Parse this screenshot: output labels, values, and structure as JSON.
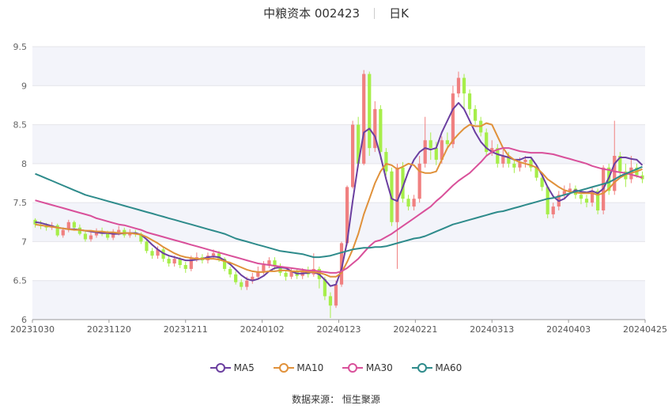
{
  "header": {
    "title": "中粮资本 002423",
    "period": "日K"
  },
  "source": {
    "label": "数据来源：",
    "name": "恒生聚源"
  },
  "colors": {
    "up": "#f08080",
    "down": "#a6ee4a",
    "MA5": "#6b3fa0",
    "MA10": "#e0913a",
    "MA30": "#d9509a",
    "MA60": "#2e8b8b",
    "grid_band": "#f3f4fa"
  },
  "chart_data": {
    "type": "candlestick",
    "ylim": [
      6,
      9.5
    ],
    "yticks": [
      "6",
      "6.5",
      "7",
      "7.5",
      "8",
      "8.5",
      "9",
      "9.5"
    ],
    "xticks": [
      "20231030",
      "20231120",
      "20231211",
      "20240102",
      "20240123",
      "20240221",
      "20240313",
      "20240403",
      "20240425"
    ],
    "candles": [
      [
        7.28,
        7.22,
        7.3,
        7.18
      ],
      [
        7.22,
        7.2,
        7.27,
        7.16
      ],
      [
        7.2,
        7.18,
        7.24,
        7.14
      ],
      [
        7.18,
        7.21,
        7.25,
        7.15
      ],
      [
        7.21,
        7.08,
        7.23,
        7.06
      ],
      [
        7.08,
        7.15,
        7.18,
        7.05
      ],
      [
        7.15,
        7.25,
        7.28,
        7.12
      ],
      [
        7.25,
        7.18,
        7.27,
        7.14
      ],
      [
        7.18,
        7.1,
        7.22,
        7.08
      ],
      [
        7.1,
        7.03,
        7.14,
        7.0
      ],
      [
        7.03,
        7.08,
        7.12,
        7.0
      ],
      [
        7.08,
        7.13,
        7.17,
        7.05
      ],
      [
        7.13,
        7.1,
        7.18,
        7.07
      ],
      [
        7.1,
        7.05,
        7.14,
        7.02
      ],
      [
        7.05,
        7.12,
        7.16,
        7.02
      ],
      [
        7.12,
        7.15,
        7.2,
        7.08
      ],
      [
        7.15,
        7.08,
        7.18,
        7.05
      ],
      [
        7.08,
        7.12,
        7.16,
        7.05
      ],
      [
        7.12,
        7.1,
        7.15,
        7.06
      ],
      [
        7.1,
        7.0,
        7.12,
        6.97
      ],
      [
        7.0,
        6.88,
        7.03,
        6.85
      ],
      [
        6.88,
        6.82,
        6.92,
        6.78
      ],
      [
        6.82,
        6.9,
        6.94,
        6.78
      ],
      [
        6.9,
        6.78,
        6.92,
        6.74
      ],
      [
        6.78,
        6.72,
        6.82,
        6.68
      ],
      [
        6.72,
        6.78,
        6.82,
        6.68
      ],
      [
        6.78,
        6.7,
        6.8,
        6.66
      ],
      [
        6.7,
        6.65,
        6.74,
        6.6
      ],
      [
        6.65,
        6.78,
        6.82,
        6.62
      ],
      [
        6.78,
        6.8,
        6.86,
        6.74
      ],
      [
        6.8,
        6.76,
        6.84,
        6.72
      ],
      [
        6.76,
        6.82,
        6.86,
        6.72
      ],
      [
        6.82,
        6.85,
        6.9,
        6.78
      ],
      [
        6.85,
        6.78,
        6.88,
        6.74
      ],
      [
        6.78,
        6.65,
        6.8,
        6.62
      ],
      [
        6.65,
        6.58,
        6.68,
        6.54
      ],
      [
        6.58,
        6.48,
        6.62,
        6.45
      ],
      [
        6.48,
        6.42,
        6.52,
        6.38
      ],
      [
        6.42,
        6.5,
        6.55,
        6.38
      ],
      [
        6.5,
        6.55,
        6.6,
        6.46
      ],
      [
        6.55,
        6.62,
        6.68,
        6.52
      ],
      [
        6.62,
        6.7,
        6.75,
        6.58
      ],
      [
        6.7,
        6.76,
        6.8,
        6.66
      ],
      [
        6.76,
        6.68,
        6.8,
        6.64
      ],
      [
        6.68,
        6.6,
        6.72,
        6.56
      ],
      [
        6.6,
        6.55,
        6.64,
        6.5
      ],
      [
        6.55,
        6.62,
        6.66,
        6.52
      ],
      [
        6.62,
        6.56,
        6.65,
        6.52
      ],
      [
        6.56,
        6.62,
        6.66,
        6.52
      ],
      [
        6.62,
        6.58,
        6.68,
        6.54
      ],
      [
        6.58,
        6.65,
        6.85,
        6.55
      ],
      [
        6.65,
        6.52,
        6.68,
        6.4
      ],
      [
        6.52,
        6.3,
        6.55,
        6.25
      ],
      [
        6.3,
        6.18,
        6.35,
        6.02
      ],
      [
        6.18,
        6.45,
        6.5,
        6.15
      ],
      [
        6.45,
        6.98,
        7.0,
        6.42
      ],
      [
        6.98,
        7.7,
        7.72,
        6.95
      ],
      [
        7.7,
        8.5,
        8.55,
        7.68
      ],
      [
        8.5,
        8.0,
        8.6,
        7.95
      ],
      [
        8.0,
        9.15,
        9.2,
        7.98
      ],
      [
        9.15,
        8.2,
        9.18,
        8.1
      ],
      [
        8.2,
        8.7,
        8.8,
        8.15
      ],
      [
        8.7,
        8.15,
        8.75,
        8.05
      ],
      [
        8.15,
        7.9,
        8.2,
        7.85
      ],
      [
        7.9,
        7.25,
        7.95,
        7.2
      ],
      [
        7.25,
        7.95,
        8.0,
        6.65
      ],
      [
        7.95,
        7.55,
        8.02,
        7.5
      ],
      [
        7.55,
        7.45,
        7.6,
        7.4
      ],
      [
        7.45,
        7.55,
        7.6,
        7.4
      ],
      [
        7.55,
        8.0,
        8.1,
        7.5
      ],
      [
        8.0,
        8.3,
        8.6,
        7.95
      ],
      [
        8.3,
        8.2,
        8.4,
        8.05
      ],
      [
        8.2,
        8.05,
        8.28,
        7.98
      ],
      [
        8.05,
        8.3,
        8.35,
        8.0
      ],
      [
        8.3,
        8.25,
        8.4,
        8.2
      ],
      [
        8.25,
        8.9,
        9.0,
        8.2
      ],
      [
        8.9,
        9.1,
        9.18,
        8.85
      ],
      [
        9.1,
        8.9,
        9.15,
        8.7
      ],
      [
        8.9,
        8.7,
        8.95,
        8.62
      ],
      [
        8.7,
        8.55,
        8.75,
        8.5
      ],
      [
        8.55,
        8.4,
        8.6,
        8.35
      ],
      [
        8.4,
        8.15,
        8.45,
        8.1
      ],
      [
        8.15,
        8.2,
        8.3,
        8.1
      ],
      [
        8.2,
        8.0,
        8.25,
        7.95
      ],
      [
        8.0,
        8.1,
        8.18,
        7.95
      ],
      [
        8.1,
        8.0,
        8.15,
        7.95
      ],
      [
        8.0,
        7.95,
        8.05,
        7.88
      ],
      [
        7.95,
        8.02,
        8.08,
        7.9
      ],
      [
        8.02,
        8.05,
        8.1,
        7.95
      ],
      [
        8.05,
        7.95,
        8.08,
        7.9
      ],
      [
        7.95,
        7.82,
        7.98,
        7.78
      ],
      [
        7.82,
        7.7,
        7.85,
        7.65
      ],
      [
        7.7,
        7.35,
        7.72,
        7.3
      ],
      [
        7.35,
        7.45,
        7.5,
        7.3
      ],
      [
        7.45,
        7.6,
        7.65,
        7.4
      ],
      [
        7.6,
        7.65,
        7.72,
        7.55
      ],
      [
        7.65,
        7.68,
        7.75,
        7.6
      ],
      [
        7.68,
        7.6,
        7.72,
        7.55
      ],
      [
        7.6,
        7.55,
        7.65,
        7.48
      ],
      [
        7.55,
        7.5,
        7.6,
        7.44
      ],
      [
        7.5,
        7.65,
        7.7,
        7.45
      ],
      [
        7.65,
        7.4,
        7.68,
        7.35
      ],
      [
        7.4,
        7.95,
        7.98,
        7.35
      ],
      [
        7.95,
        7.65,
        8.0,
        7.6
      ],
      [
        7.65,
        8.1,
        8.55,
        7.6
      ],
      [
        8.1,
        7.9,
        8.15,
        7.85
      ],
      [
        7.9,
        7.8,
        8.0,
        7.7
      ],
      [
        7.8,
        7.95,
        8.1,
        7.75
      ],
      [
        7.95,
        7.85,
        8.0,
        7.82
      ],
      [
        7.85,
        7.8,
        7.9,
        7.75
      ]
    ],
    "series": [
      {
        "name": "MA5",
        "values": [
          7.25,
          7.24,
          7.22,
          7.2,
          7.18,
          7.17,
          7.16,
          7.16,
          7.15,
          7.14,
          7.13,
          7.12,
          7.11,
          7.11,
          7.1,
          7.1,
          7.11,
          7.11,
          7.11,
          7.09,
          7.03,
          6.96,
          6.9,
          6.85,
          6.82,
          6.8,
          6.78,
          6.76,
          6.76,
          6.77,
          6.78,
          6.8,
          6.81,
          6.8,
          6.76,
          6.71,
          6.64,
          6.57,
          6.52,
          6.5,
          6.52,
          6.56,
          6.62,
          6.66,
          6.67,
          6.66,
          6.62,
          6.59,
          6.59,
          6.6,
          6.61,
          6.58,
          6.51,
          6.43,
          6.45,
          6.65,
          7.0,
          7.52,
          8.0,
          8.4,
          8.45,
          8.35,
          8.1,
          7.8,
          7.55,
          7.52,
          7.7,
          7.9,
          8.05,
          8.15,
          8.2,
          8.18,
          8.2,
          8.4,
          8.55,
          8.7,
          8.78,
          8.7,
          8.55,
          8.4,
          8.28,
          8.2,
          8.15,
          8.12,
          8.1,
          8.08,
          8.05,
          8.05,
          8.08,
          8.08,
          7.98,
          7.85,
          7.7,
          7.58,
          7.52,
          7.55,
          7.62,
          7.66,
          7.64,
          7.63,
          7.65,
          7.62,
          7.68,
          7.82,
          8.0,
          8.08,
          8.08,
          8.06,
          8.05,
          7.98
        ]
      },
      {
        "name": "MA10",
        "values": [
          7.22,
          7.21,
          7.2,
          7.19,
          7.18,
          7.17,
          7.16,
          7.15,
          7.15,
          7.14,
          7.14,
          7.13,
          7.13,
          7.12,
          7.12,
          7.11,
          7.11,
          7.11,
          7.1,
          7.09,
          7.06,
          7.02,
          6.98,
          6.93,
          6.89,
          6.85,
          6.82,
          6.8,
          6.79,
          6.78,
          6.78,
          6.78,
          6.78,
          6.77,
          6.75,
          6.73,
          6.7,
          6.67,
          6.64,
          6.62,
          6.61,
          6.61,
          6.62,
          6.62,
          6.63,
          6.63,
          6.62,
          6.62,
          6.62,
          6.61,
          6.61,
          6.6,
          6.58,
          6.55,
          6.55,
          6.6,
          6.74,
          6.9,
          7.1,
          7.35,
          7.55,
          7.75,
          7.9,
          8.0,
          7.98,
          7.93,
          7.96,
          8.0,
          7.98,
          7.9,
          7.88,
          7.88,
          7.9,
          8.05,
          8.2,
          8.3,
          8.38,
          8.45,
          8.5,
          8.48,
          8.48,
          8.52,
          8.5,
          8.35,
          8.2,
          8.1,
          8.05,
          8.02,
          8.0,
          7.98,
          7.95,
          7.88,
          7.8,
          7.75,
          7.7,
          7.66,
          7.64,
          7.63,
          7.62,
          7.62,
          7.62,
          7.6,
          7.62,
          7.68,
          7.76,
          7.82,
          7.86,
          7.88,
          7.9,
          7.93
        ]
      },
      {
        "name": "MA30",
        "values": [
          7.53,
          7.51,
          7.49,
          7.47,
          7.45,
          7.43,
          7.41,
          7.39,
          7.37,
          7.35,
          7.33,
          7.3,
          7.28,
          7.26,
          7.24,
          7.22,
          7.21,
          7.19,
          7.17,
          7.15,
          7.12,
          7.1,
          7.08,
          7.06,
          7.04,
          7.02,
          7.0,
          6.98,
          6.96,
          6.94,
          6.92,
          6.9,
          6.88,
          6.86,
          6.84,
          6.82,
          6.8,
          6.78,
          6.76,
          6.74,
          6.72,
          6.71,
          6.7,
          6.69,
          6.68,
          6.67,
          6.66,
          6.65,
          6.64,
          6.63,
          6.63,
          6.62,
          6.61,
          6.6,
          6.6,
          6.62,
          6.66,
          6.72,
          6.78,
          6.86,
          6.94,
          7.0,
          7.02,
          7.06,
          7.1,
          7.15,
          7.2,
          7.25,
          7.3,
          7.35,
          7.4,
          7.45,
          7.52,
          7.58,
          7.65,
          7.72,
          7.78,
          7.83,
          7.88,
          7.95,
          8.02,
          8.1,
          8.15,
          8.18,
          8.2,
          8.2,
          8.18,
          8.16,
          8.15,
          8.14,
          8.14,
          8.14,
          8.13,
          8.12,
          8.1,
          8.08,
          8.06,
          8.04,
          8.02,
          8.0,
          7.97,
          7.95,
          7.93,
          7.92,
          7.9,
          7.89,
          7.88,
          7.86,
          7.84,
          7.82
        ]
      },
      {
        "name": "MA60",
        "values": [
          7.87,
          7.84,
          7.81,
          7.78,
          7.75,
          7.72,
          7.69,
          7.66,
          7.63,
          7.6,
          7.58,
          7.56,
          7.54,
          7.52,
          7.5,
          7.48,
          7.46,
          7.44,
          7.42,
          7.4,
          7.38,
          7.36,
          7.34,
          7.32,
          7.3,
          7.28,
          7.26,
          7.24,
          7.22,
          7.2,
          7.18,
          7.16,
          7.14,
          7.12,
          7.1,
          7.07,
          7.04,
          7.02,
          7.0,
          6.98,
          6.96,
          6.94,
          6.92,
          6.9,
          6.88,
          6.87,
          6.86,
          6.85,
          6.84,
          6.82,
          6.8,
          6.8,
          6.81,
          6.82,
          6.84,
          6.86,
          6.88,
          6.9,
          6.91,
          6.92,
          6.92,
          6.93,
          6.93,
          6.94,
          6.96,
          6.98,
          7.0,
          7.02,
          7.04,
          7.05,
          7.07,
          7.1,
          7.13,
          7.16,
          7.19,
          7.22,
          7.24,
          7.26,
          7.28,
          7.3,
          7.32,
          7.34,
          7.36,
          7.38,
          7.39,
          7.41,
          7.43,
          7.45,
          7.47,
          7.49,
          7.51,
          7.53,
          7.55,
          7.56,
          7.58,
          7.6,
          7.62,
          7.64,
          7.66,
          7.68,
          7.7,
          7.72,
          7.74,
          7.76,
          7.8,
          7.84,
          7.87,
          7.9,
          7.93,
          7.96
        ]
      }
    ]
  }
}
